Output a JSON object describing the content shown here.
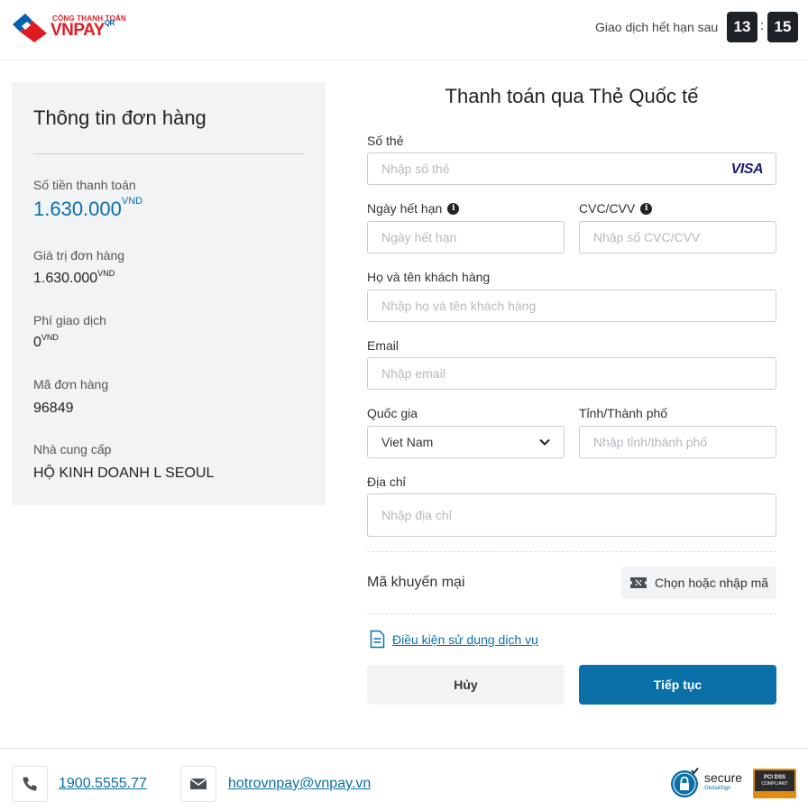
{
  "header": {
    "logo": {
      "tagline": "CỔNG THANH TOÁN",
      "brand": "VNPAY",
      "suffix": "QR"
    },
    "expire_label": "Giao dịch hết hạn sau",
    "timer": {
      "minutes": "13",
      "separator": ":",
      "seconds": "15"
    }
  },
  "order": {
    "title": "Thông tin đơn hàng",
    "items": [
      {
        "label": "Số tiền thanh toán",
        "value": "1.630.000",
        "unit": "VND"
      },
      {
        "label": "Giá trị đơn hàng",
        "value": "1.630.000",
        "unit": "VND"
      },
      {
        "label": "Phí giao dịch",
        "value": "0",
        "unit": "VND"
      },
      {
        "label": "Mã đơn hàng",
        "value": "96849"
      },
      {
        "label": "Nhà cung cấp",
        "value": "HỘ KINH DOANH L SEOUL"
      }
    ]
  },
  "form": {
    "title": "Thanh toán qua Thẻ Quốc tế",
    "card_number": {
      "label": "Số thẻ",
      "placeholder": "Nhập số thẻ",
      "brand": "VISA"
    },
    "expiry": {
      "label": "Ngày hết hạn",
      "placeholder": "Ngày hết hạn"
    },
    "cvc": {
      "label": "CVC/CVV",
      "placeholder": "Nhập số CVC/CVV"
    },
    "name": {
      "label": "Họ và tên khách hàng",
      "placeholder": "Nhập họ và tên khách hàng"
    },
    "email": {
      "label": "Email",
      "placeholder": "Nhập email"
    },
    "country": {
      "label": "Quốc gia",
      "value": "Viet Nam"
    },
    "city": {
      "label": "Tỉnh/Thành phố",
      "placeholder": "Nhập tỉnh/thành phố"
    },
    "address": {
      "label": "Địa chỉ",
      "placeholder": "Nhập địa chỉ"
    },
    "promo": {
      "label": "Mã khuyến mại",
      "button": "Chọn hoặc nhập mã"
    },
    "terms": "Điều kiện sử dụng dịch vụ",
    "cancel": "Hủy",
    "continue": "Tiếp tục"
  },
  "footer": {
    "phone": "1900.5555.77",
    "email": "hotrovnpay@vnpay.vn",
    "secure_badge": {
      "title": "secure",
      "subtitle": "GlobalSign"
    },
    "pci_badge": {
      "line1": "PCI DSS",
      "line2": "COMPLIANT"
    }
  },
  "colors": {
    "primary": "#0b6fa8",
    "brand_red": "#e11b22",
    "panel_bg": "#f1f3f5",
    "timer_bg": "#1e2227"
  }
}
